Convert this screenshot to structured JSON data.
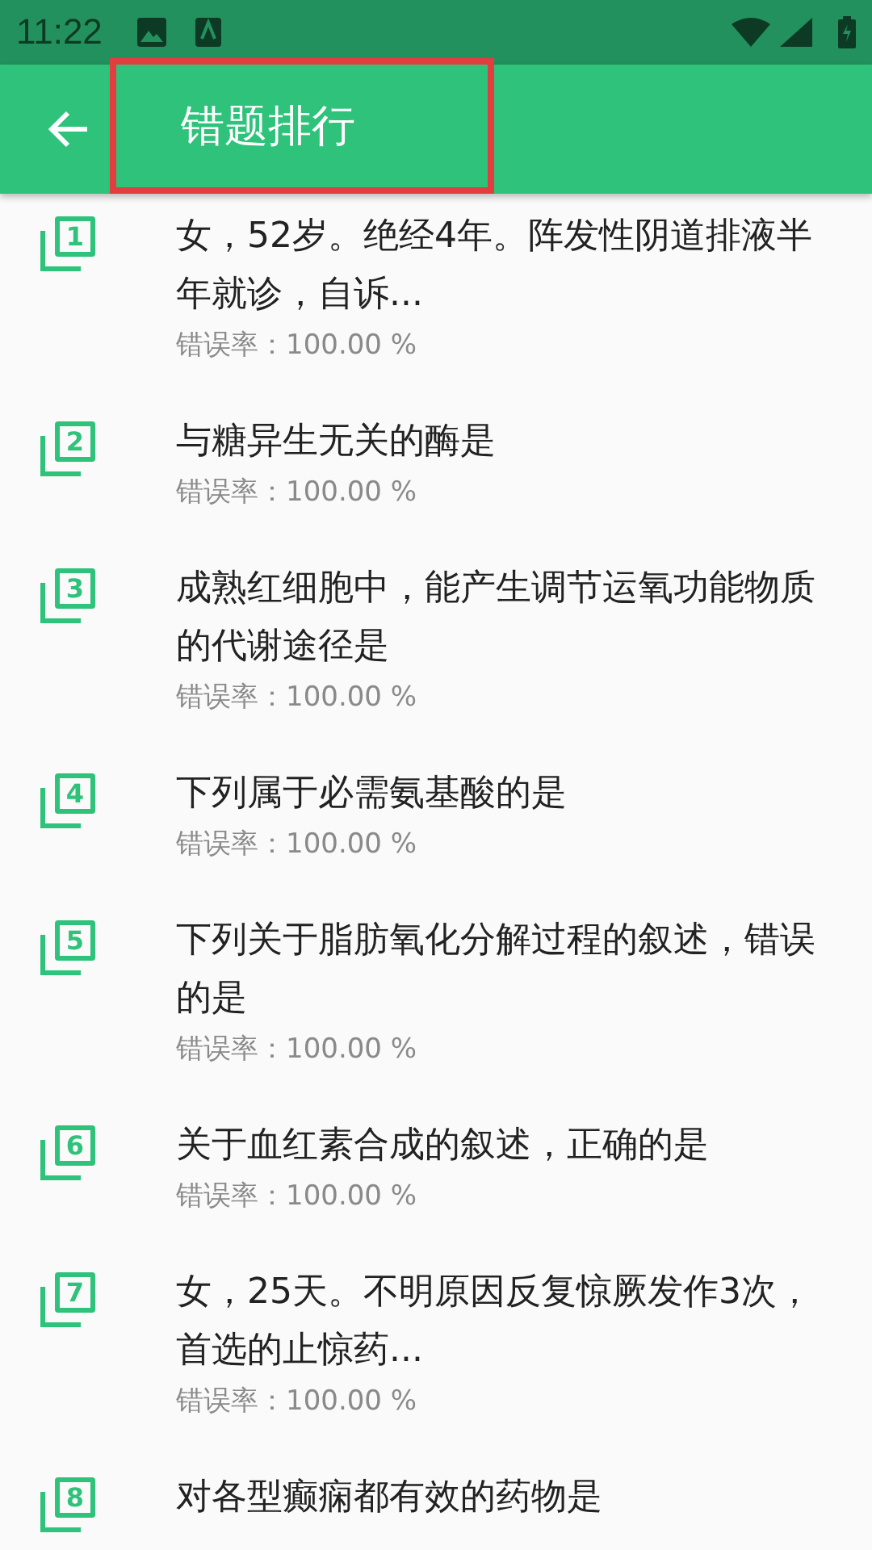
{
  "status_bar": {
    "time": "11:22"
  },
  "app_bar": {
    "title": "错题排行",
    "title_highlighted": true
  },
  "items": [
    {
      "number": "1",
      "question": "女，52岁。绝经4年。阵发性阴道排液半年就诊，自诉...",
      "rate": "错误率：100.00 %"
    },
    {
      "number": "2",
      "question": "与糖异生无关的酶是",
      "rate": "错误率：100.00 %"
    },
    {
      "number": "3",
      "question": "成熟红细胞中，能产生调节运氧功能物质的代谢途径是",
      "rate": "错误率：100.00 %"
    },
    {
      "number": "4",
      "question": "下列属于必需氨基酸的是",
      "rate": "错误率：100.00 %"
    },
    {
      "number": "5",
      "question": "下列关于脂肪氧化分解过程的叙述，错误的是",
      "rate": "错误率：100.00 %"
    },
    {
      "number": "6",
      "question": "关于血红素合成的叙述，正确的是",
      "rate": "错误率：100.00 %"
    },
    {
      "number": "7",
      "question": "女，25天。不明原因反复惊厥发作3次，首选的止惊药...",
      "rate": "错误率：100.00 %"
    },
    {
      "number": "8",
      "question": "对各型癫痫都有效的药物是"
    }
  ]
}
